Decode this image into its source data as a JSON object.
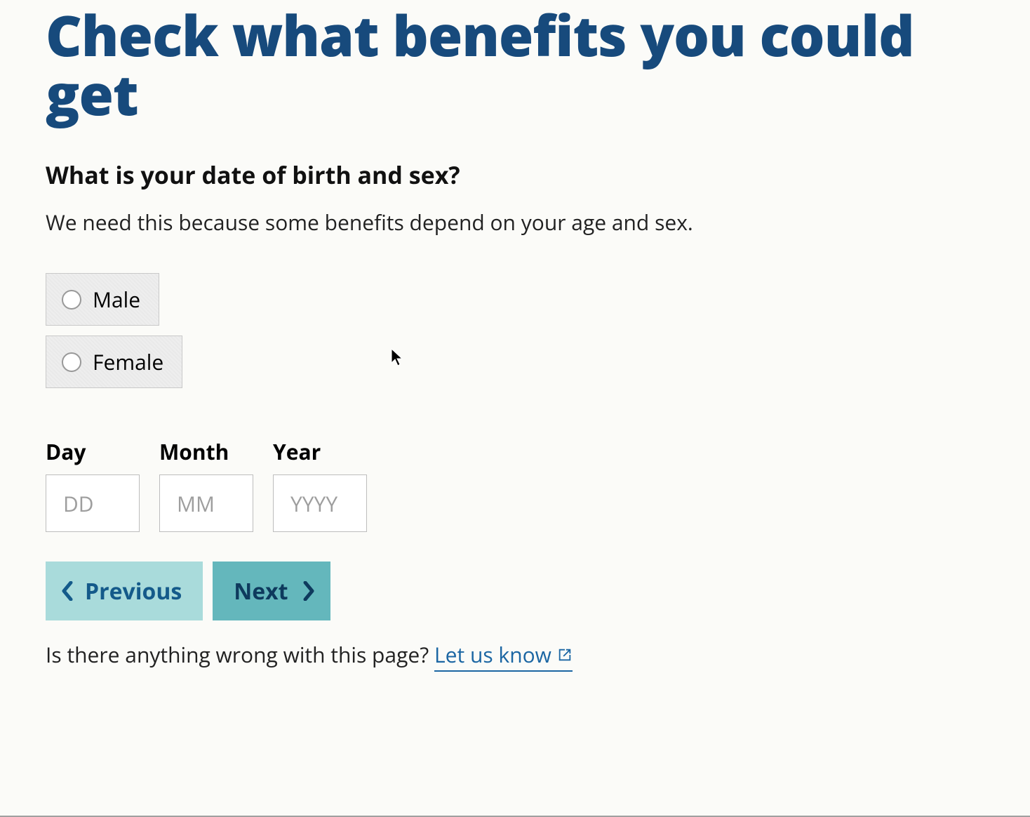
{
  "page": {
    "title": "Check what benefits you could get"
  },
  "question": {
    "heading": "What is your date of birth and sex?",
    "hint": "We need this because some benefits depend on your age and sex."
  },
  "sex": {
    "options": [
      {
        "label": "Male"
      },
      {
        "label": "Female"
      }
    ]
  },
  "dob": {
    "day": {
      "label": "Day",
      "placeholder": "DD",
      "value": ""
    },
    "month": {
      "label": "Month",
      "placeholder": "MM",
      "value": ""
    },
    "year": {
      "label": "Year",
      "placeholder": "YYYY",
      "value": ""
    }
  },
  "nav": {
    "previous": "Previous",
    "next": "Next"
  },
  "feedback": {
    "prompt": "Is there anything wrong with this page? ",
    "link_text": "Let us know"
  }
}
